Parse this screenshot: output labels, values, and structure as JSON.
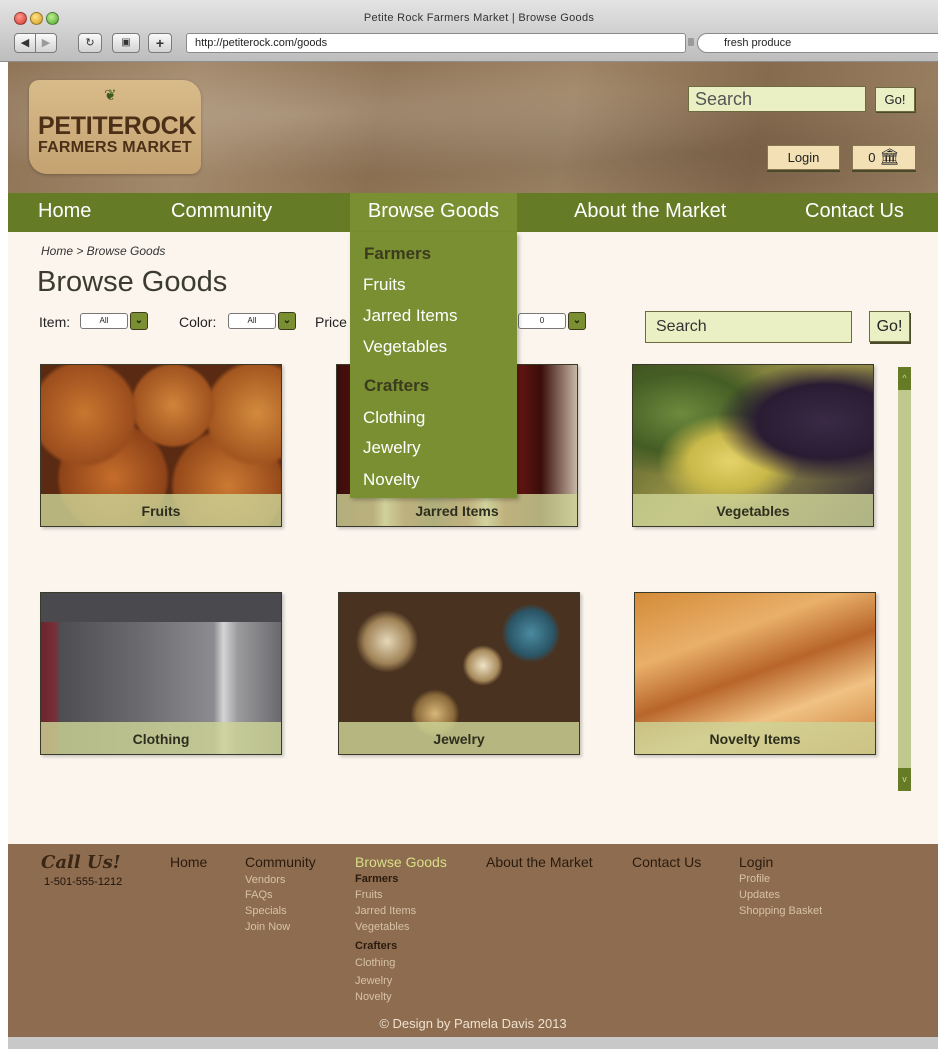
{
  "browser": {
    "window_title": "Petite Rock Farmers Market | Browse Goods",
    "url": "http://petiterock.com/goods",
    "search_value": "fresh produce",
    "back_glyph": "◀",
    "forward_glyph": "▶",
    "reload_glyph": "↻",
    "image_glyph": "▣",
    "add_glyph": "+"
  },
  "logo": {
    "line1": "PETITEROCK",
    "line2": "FARMERS MARKET",
    "sprout_icon": "❦"
  },
  "header": {
    "search_placeholder": "Search",
    "go_label": "Go!",
    "login_label": "Login",
    "cart_count": "0",
    "cart_icon": "🏛"
  },
  "nav": {
    "home": "Home",
    "community": "Community",
    "browse": "Browse Goods",
    "about": "About the Market",
    "contact": "Contact Us"
  },
  "dropdown": {
    "farmers_heading": "Farmers",
    "farmers_items": [
      "Fruits",
      "Jarred Items",
      "Vegetables"
    ],
    "crafters_heading": "Crafters",
    "crafters_items": [
      "Clothing",
      "Jewelry",
      "Novelty"
    ]
  },
  "breadcrumb": "Home > Browse Goods",
  "page_title": "Browse Goods",
  "filters": {
    "item_label": "Item:",
    "item_value": "All",
    "color_label": "Color:",
    "color_value": "All",
    "price_label": "Price",
    "price_value": "0",
    "arrow_glyph": "⌄",
    "search_placeholder": "Search",
    "go_label": "Go!"
  },
  "tiles": [
    "Fruits",
    "Jarred Items",
    "Vegetables",
    "Clothing",
    "Jewelry",
    "Novelty Items"
  ],
  "scrollbar": {
    "up_glyph": "^",
    "down_glyph": "v"
  },
  "footer": {
    "call_title": "Call Us!",
    "phone": "1-501-555-1212",
    "home": "Home",
    "community": "Community",
    "community_links": [
      "Vendors",
      "FAQs",
      "Specials",
      "Join Now"
    ],
    "browse": "Browse Goods",
    "farmers": "Farmers",
    "farmers_links": [
      "Fruits",
      "Jarred Items",
      "Vegetables"
    ],
    "crafters": "Crafters",
    "crafters_links": [
      "Clothing",
      "Jewelry",
      "Novelty"
    ],
    "about": "About the Market",
    "contact": "Contact Us",
    "login": "Login",
    "login_links": [
      "Profile",
      "Updates",
      "Shopping Basket"
    ],
    "credit": "© Design by Pamela Davis 2013"
  },
  "colors": {
    "nav_green": "#667b25",
    "active_green": "#7a8f32",
    "footer_brown": "#8e6c50",
    "page_bg": "#fbf5ee",
    "input_bg": "#ebf0c4"
  }
}
